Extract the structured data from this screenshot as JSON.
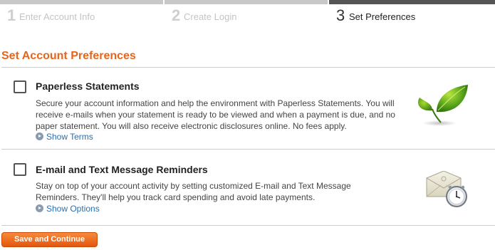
{
  "steps": [
    {
      "number": "1",
      "label": "Enter Account Info",
      "state": "inactive"
    },
    {
      "number": "2",
      "label": "Create Login",
      "state": "inactive"
    },
    {
      "number": "3",
      "label": "Set Preferences",
      "state": "active"
    }
  ],
  "section_title": "Set Account Preferences",
  "options": [
    {
      "title": "Paperless Statements",
      "description": "Secure your account information and help the environment with Paperless Statements. You will receive e-mails when your statement is ready to be viewed and when a payment is due, and no paper statement. You will also receive electronic disclosures online. No fees apply.",
      "link": "Show Terms",
      "checked": false,
      "icon": "leaf-icon"
    },
    {
      "title": "E-mail and Text Message Reminders",
      "description": "Stay on top of your account activity by setting customized E-mail and Text Message Reminders. They'll help you track card spending and avoid late payments.",
      "link": "Show Options",
      "checked": false,
      "icon": "envelope-clock-icon"
    }
  ],
  "submit_label": "Save and Continue",
  "colors": {
    "accent": "#e8641b",
    "link": "#2a6fb0",
    "active_step_bar": "#555555",
    "inactive_step_bar": "#c8c8c8"
  }
}
